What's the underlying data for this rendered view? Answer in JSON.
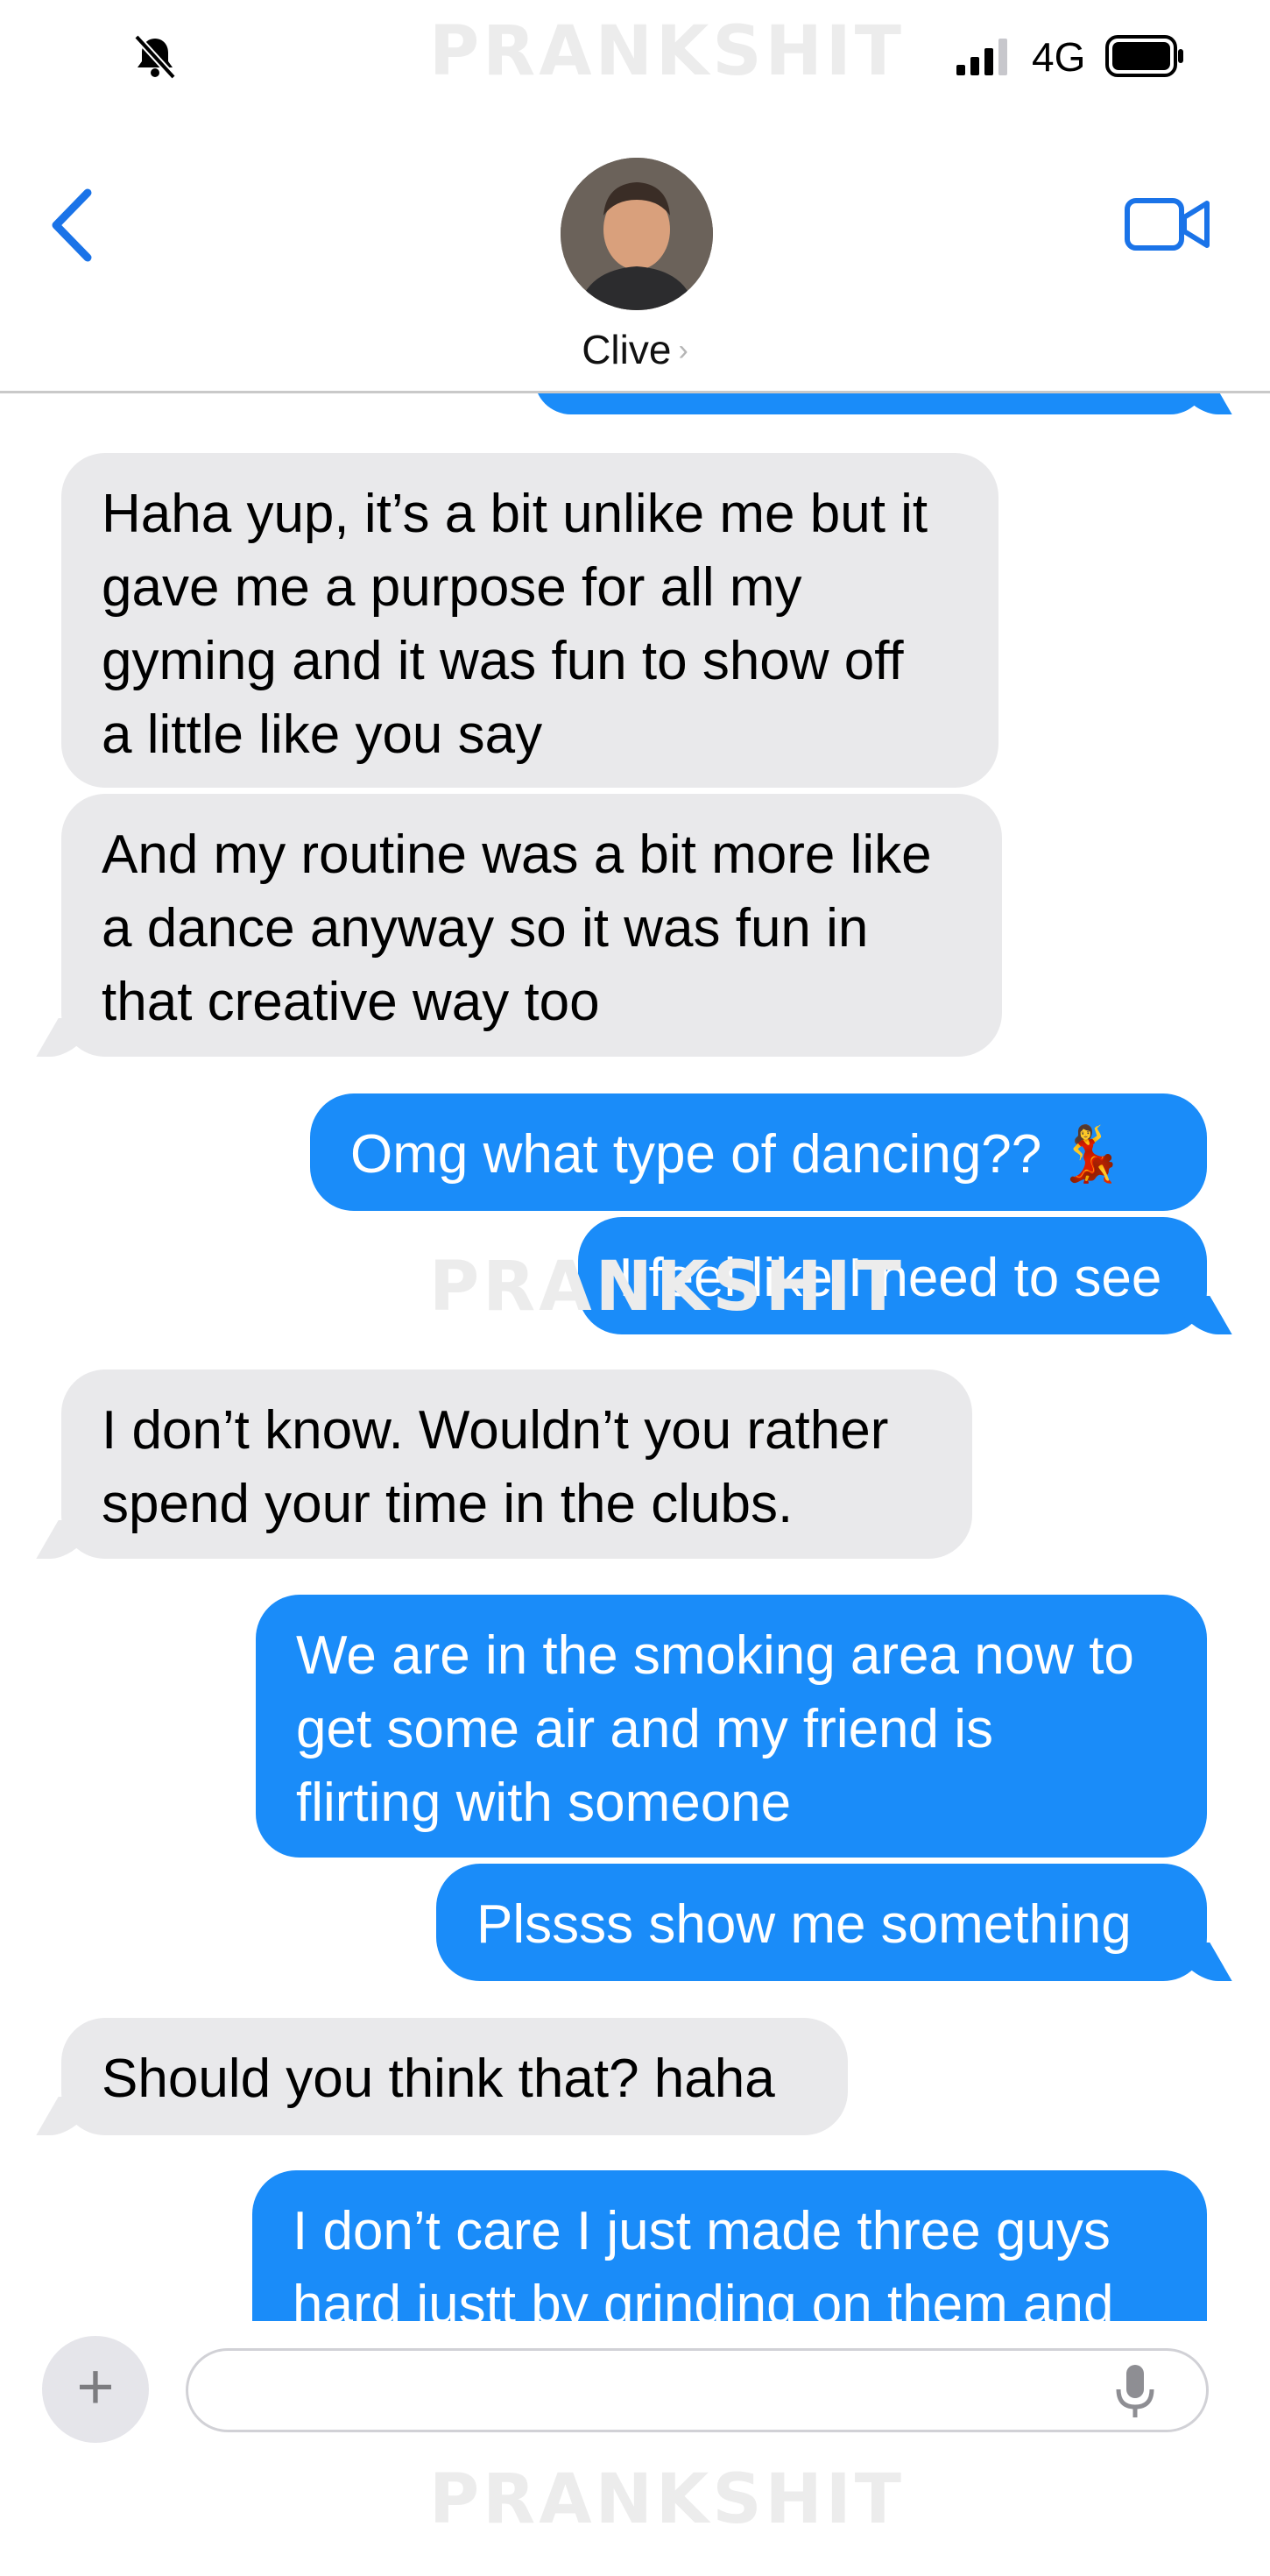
{
  "status_bar": {
    "network": "4G",
    "icons": [
      "bell-slash-icon",
      "signal-bars-icon",
      "battery-icon"
    ]
  },
  "watermark": "PRANKSHIT",
  "header": {
    "contact_name": "Clive",
    "chevron": "›",
    "icons": [
      "back-chevron-icon",
      "video-call-icon"
    ]
  },
  "colors": {
    "sent_bubble": "#1a8cf9",
    "received_bubble": "#e9e9eb",
    "accent": "#1a73e8"
  },
  "messages": [
    {
      "dir": "received",
      "text": "Haha yup, it’s a bit unlike me but it\ngave me a purpose for all my\ngyming and it was fun to show off\na little like you say"
    },
    {
      "dir": "received",
      "text": "And my routine was a bit more like\na dance anyway so it was fun in\nthat creative way too"
    },
    {
      "dir": "sent",
      "text": "Omg what type of dancing?? 💃"
    },
    {
      "dir": "sent",
      "text": "I feel like I need to see"
    },
    {
      "dir": "received",
      "text": "I don’t know. Wouldn’t you rather\nspend your time in the clubs."
    },
    {
      "dir": "sent",
      "text": "We are in the smoking area now to\nget some air and my friend is\nflirting with someone"
    },
    {
      "dir": "sent",
      "text": "Plssss show me something"
    },
    {
      "dir": "received",
      "text": "Should you think that? haha"
    },
    {
      "dir": "sent",
      "text": "I don’t care I just made three guys\nhard justt by grinding on them and"
    }
  ],
  "compose": {
    "plus_label": "+",
    "icons": [
      "plus-icon",
      "microphone-icon"
    ]
  }
}
